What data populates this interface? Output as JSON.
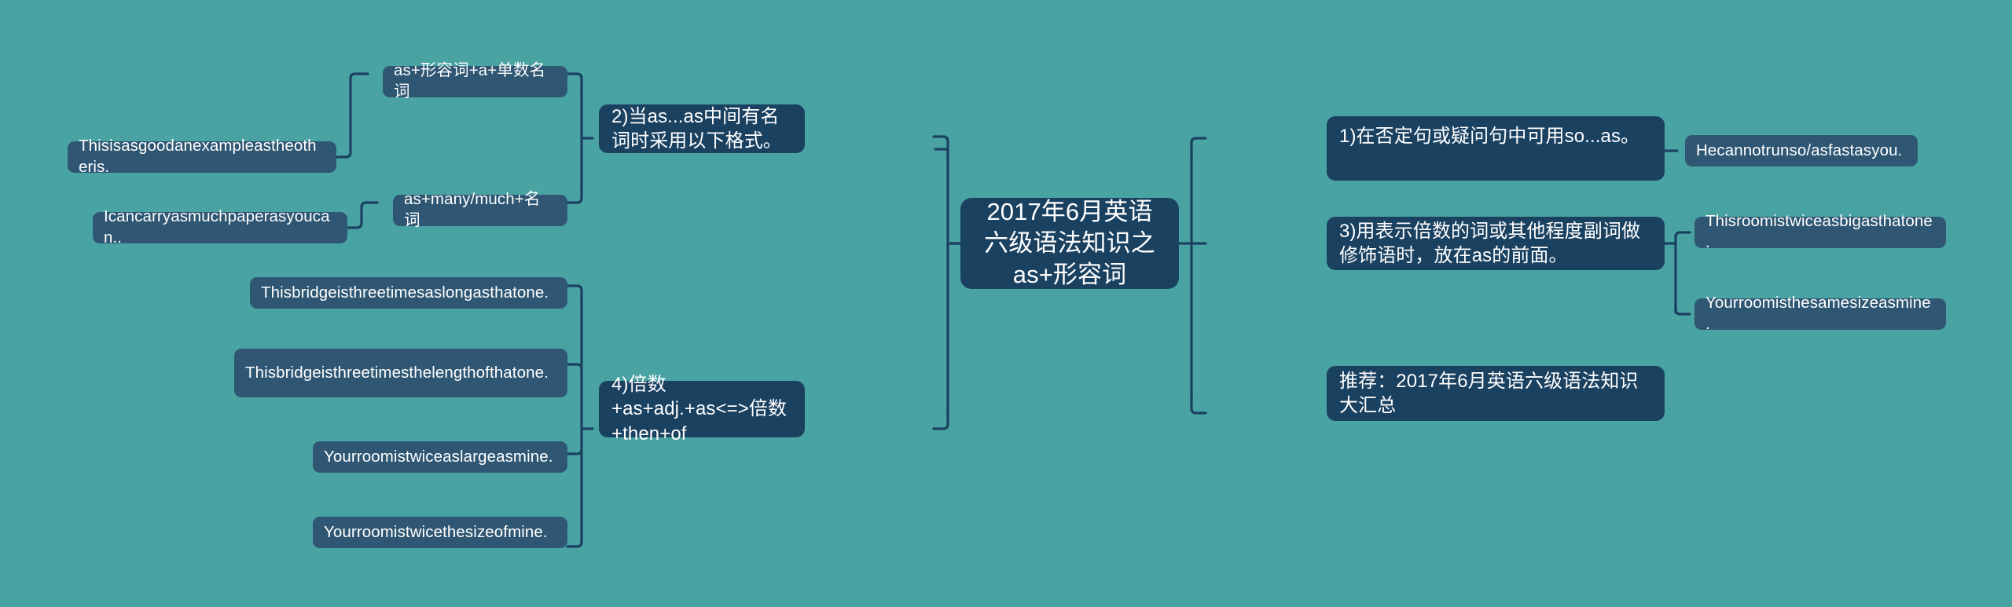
{
  "meta": {
    "background_color": "#4aa3a3",
    "branch_node_color": "#1b4161",
    "leaf_node_color": "#2f5672",
    "connector_color": "#1b4161",
    "text_color": "#ffffff"
  },
  "root": {
    "label": "2017年6月英语六级语法知识之as+形容词"
  },
  "left_branches": [
    {
      "label": "2)当as...as中间有名词时采用以下格式。",
      "children": [
        {
          "label": "as+形容词+a+单数名词",
          "children": [
            {
              "label": "Thisisasgoodanexampleastheotheris."
            }
          ]
        },
        {
          "label": "as+many/much+名词",
          "children": [
            {
              "label": "Icancarryasmuchpaperasyoucan.."
            }
          ]
        }
      ]
    },
    {
      "label": "4)倍数+as+adj.+as<=>倍数+then+of",
      "children": [
        {
          "label": "Thisbridgeisthreetimesaslongasthatone."
        },
        {
          "label": "Thisbridgeisthreetimesthelengthofthatone."
        },
        {
          "label": "Yourroomistwiceaslargeasmine."
        },
        {
          "label": "Yourroomistwicethesizeofmine."
        }
      ]
    }
  ],
  "right_branches": [
    {
      "label": "1)在否定句或疑问句中可用so...as。",
      "children": [
        {
          "label": "Hecannotrunso/asfastasyou."
        }
      ]
    },
    {
      "label": "3)用表示倍数的词或其他程度副词做修饰语时，放在as的前面。",
      "children": [
        {
          "label": "Thisroomistwiceasbigasthatone."
        },
        {
          "label": "Yourroomisthesamesizeasmine."
        }
      ]
    },
    {
      "label": "推荐：2017年6月英语六级语法知识大汇总",
      "children": []
    }
  ]
}
